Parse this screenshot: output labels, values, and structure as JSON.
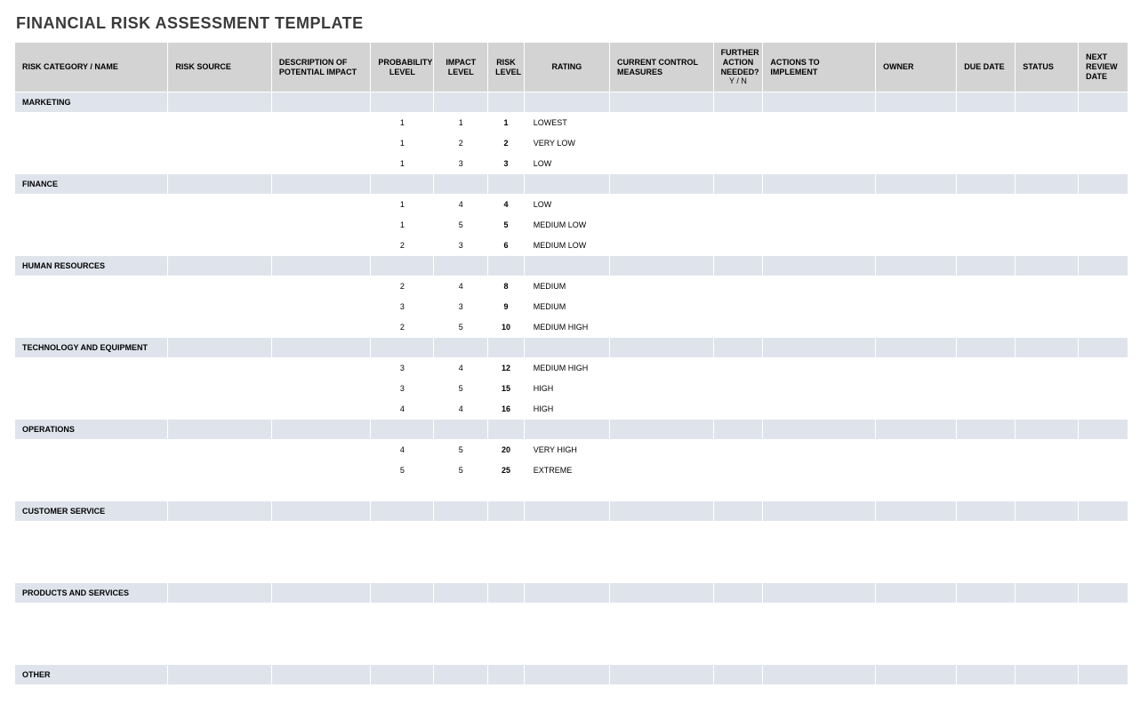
{
  "title": "FINANCIAL RISK ASSESSMENT TEMPLATE",
  "headers": [
    "RISK CATEGORY / NAME",
    "RISK SOURCE",
    "DESCRIPTION OF POTENTIAL IMPACT",
    "PROBABILITY LEVEL",
    "IMPACT LEVEL",
    "RISK LEVEL",
    "RATING",
    "CURRENT CONTROL MEASURES",
    "FURTHER ACTION NEEDED?",
    "ACTIONS TO IMPLEMENT",
    "OWNER",
    "DUE DATE",
    "STATUS",
    "NEXT REVIEW DATE"
  ],
  "header_sub": {
    "further_action": "Y / N"
  },
  "sections": [
    {
      "name": "MARKETING",
      "rows": [
        {
          "prob": "1",
          "impact": "1",
          "level": "1",
          "rating": "LOWEST",
          "cls": "c-lowest"
        },
        {
          "prob": "1",
          "impact": "2",
          "level": "2",
          "rating": "VERY LOW",
          "cls": "c-verylow"
        },
        {
          "prob": "1",
          "impact": "3",
          "level": "3",
          "rating": "LOW",
          "cls": "c-low1"
        }
      ]
    },
    {
      "name": "FINANCE",
      "rows": [
        {
          "prob": "1",
          "impact": "4",
          "level": "4",
          "rating": "LOW",
          "cls": "c-low2"
        },
        {
          "prob": "1",
          "impact": "5",
          "level": "5",
          "rating": "MEDIUM LOW",
          "cls": "c-medlow1"
        },
        {
          "prob": "2",
          "impact": "3",
          "level": "6",
          "rating": "MEDIUM LOW",
          "cls": "c-medlow2"
        }
      ]
    },
    {
      "name": "HUMAN RESOURCES",
      "rows": [
        {
          "prob": "2",
          "impact": "4",
          "level": "8",
          "rating": "MEDIUM",
          "cls": "c-medium1"
        },
        {
          "prob": "3",
          "impact": "3",
          "level": "9",
          "rating": "MEDIUM",
          "cls": "c-medium2"
        },
        {
          "prob": "2",
          "impact": "5",
          "level": "10",
          "rating": "MEDIUM HIGH",
          "cls": "c-medhigh1"
        }
      ]
    },
    {
      "name": "TECHNOLOGY AND EQUIPMENT",
      "rows": [
        {
          "prob": "3",
          "impact": "4",
          "level": "12",
          "rating": "MEDIUM HIGH",
          "cls": "c-medhigh2"
        },
        {
          "prob": "3",
          "impact": "5",
          "level": "15",
          "rating": "HIGH",
          "cls": "c-high1"
        },
        {
          "prob": "4",
          "impact": "4",
          "level": "16",
          "rating": "HIGH",
          "cls": "c-high2"
        }
      ]
    },
    {
      "name": "OPERATIONS",
      "rows": [
        {
          "prob": "4",
          "impact": "5",
          "level": "20",
          "rating": "VERY HIGH",
          "cls": "c-veryhigh"
        },
        {
          "prob": "5",
          "impact": "5",
          "level": "25",
          "rating": "EXTREME",
          "cls": "c-extreme"
        },
        {
          "prob": "",
          "impact": "",
          "level": "",
          "rating": "",
          "cls": ""
        }
      ]
    },
    {
      "name": "CUSTOMER SERVICE",
      "rows": [
        {
          "prob": "",
          "impact": "",
          "level": "",
          "rating": "",
          "cls": ""
        },
        {
          "prob": "",
          "impact": "",
          "level": "",
          "rating": "",
          "cls": ""
        },
        {
          "prob": "",
          "impact": "",
          "level": "",
          "rating": "",
          "cls": ""
        }
      ]
    },
    {
      "name": "PRODUCTS AND SERVICES",
      "rows": [
        {
          "prob": "",
          "impact": "",
          "level": "",
          "rating": "",
          "cls": ""
        },
        {
          "prob": "",
          "impact": "",
          "level": "",
          "rating": "",
          "cls": ""
        },
        {
          "prob": "",
          "impact": "",
          "level": "",
          "rating": "",
          "cls": ""
        }
      ]
    },
    {
      "name": "OTHER",
      "rows": [
        {
          "prob": "",
          "impact": "",
          "level": "",
          "rating": "",
          "cls": ""
        }
      ]
    }
  ]
}
